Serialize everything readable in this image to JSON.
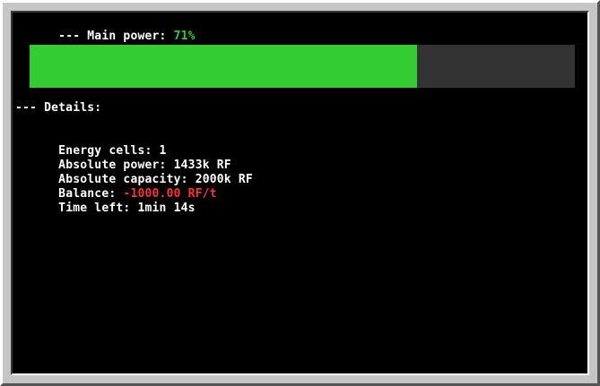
{
  "main_power": {
    "label": "--- Main power: ",
    "percent_text": "71%",
    "fill_fraction": 0.71,
    "fill_color": "#33cc33",
    "track_color": "#333333"
  },
  "details": {
    "header": "--- Details:",
    "rows": [
      {
        "label": "Energy cells: ",
        "value": "1"
      },
      {
        "label": "Absolute power: ",
        "value": "1433k RF"
      },
      {
        "label": "Absolute capacity: ",
        "value": "2000k RF"
      },
      {
        "label": "Balance: ",
        "value": "-1000.00 RF/t",
        "value_color": "#ff3333"
      },
      {
        "label": "Time left: ",
        "value": "1min 14s"
      }
    ]
  }
}
